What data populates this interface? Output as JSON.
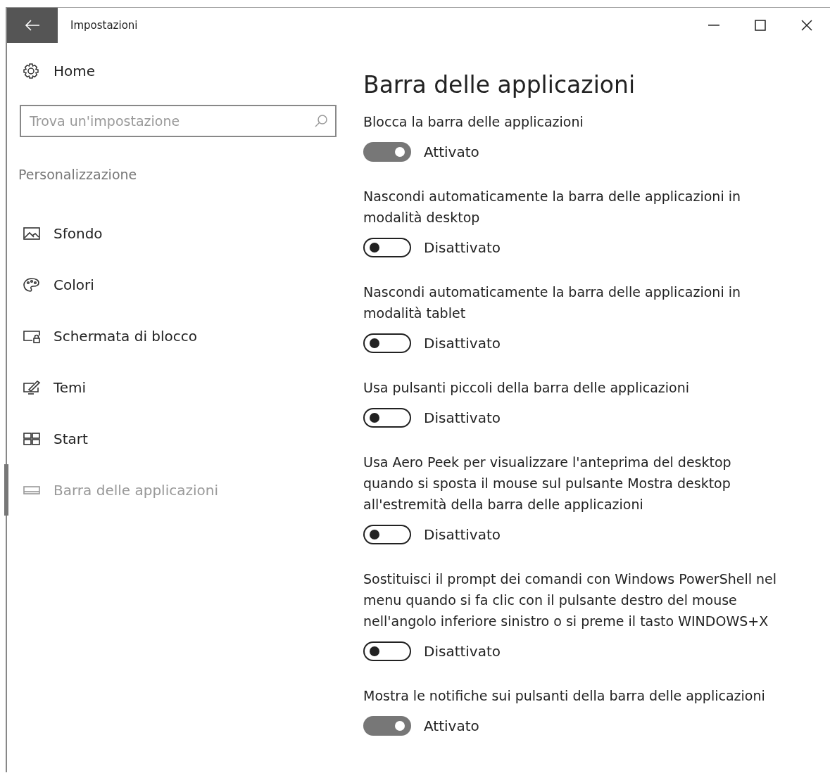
{
  "window": {
    "title": "Impostazioni"
  },
  "sidebar": {
    "home": "Home",
    "search": {
      "placeholder": "Trova un'impostazione"
    },
    "section": "Personalizzazione",
    "items": [
      {
        "label": "Sfondo",
        "selected": false
      },
      {
        "label": "Colori",
        "selected": false
      },
      {
        "label": "Schermata di blocco",
        "selected": false
      },
      {
        "label": "Temi",
        "selected": false
      },
      {
        "label": "Start",
        "selected": false
      },
      {
        "label": "Barra delle applicazioni",
        "selected": true
      }
    ]
  },
  "page": {
    "title": "Barra delle applicazioni",
    "settings": [
      {
        "label": "Blocca la barra delle applicazioni",
        "on": true,
        "state": "Attivato"
      },
      {
        "label": "Nascondi automaticamente la barra delle applicazioni in modalità desktop",
        "on": false,
        "state": "Disattivato"
      },
      {
        "label": "Nascondi automaticamente la barra delle applicazioni in modalità tablet",
        "on": false,
        "state": "Disattivato"
      },
      {
        "label": "Usa pulsanti piccoli della barra delle applicazioni",
        "on": false,
        "state": "Disattivato"
      },
      {
        "label": "Usa Aero Peek per visualizzare l'anteprima del desktop quando si sposta il mouse sul pulsante Mostra desktop all'estremità della barra delle applicazioni",
        "on": false,
        "state": "Disattivato"
      },
      {
        "label": "Sostituisci il prompt dei comandi con Windows PowerShell nel menu quando si fa clic con il pulsante destro del mouse nell'angolo inferiore sinistro o si preme il tasto WINDOWS+X",
        "on": false,
        "state": "Disattivato"
      },
      {
        "label": "Mostra le notifiche sui pulsanti della barra delle applicazioni",
        "on": true,
        "state": "Attivato"
      }
    ]
  }
}
